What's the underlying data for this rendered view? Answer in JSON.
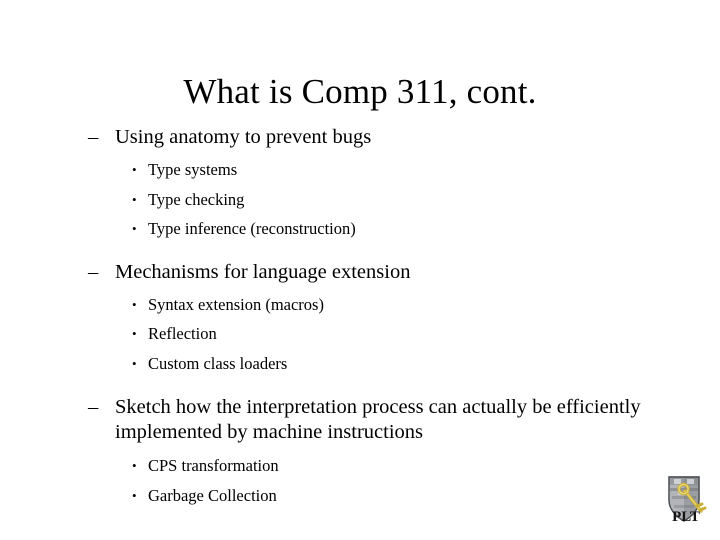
{
  "slide": {
    "title": "What is Comp 311, cont.",
    "background_color": "#ffffff",
    "text_color": "#000000",
    "dash_marker": "–",
    "dot_marker": "•",
    "groups": [
      {
        "heading": "Using anatomy to prevent bugs",
        "items": [
          "Type systems",
          "Type checking",
          "Type inference (reconstruction)"
        ]
      },
      {
        "heading": "Mechanisms for language extension",
        "items": [
          "Syntax extension (macros)",
          "Reflection",
          "Custom class loaders"
        ]
      },
      {
        "heading": "Sketch how the interpretation process can actually be efficiently implemented by machine instructions",
        "items": [
          "CPS transformation",
          "Garbage Collection"
        ]
      }
    ]
  },
  "logo": {
    "name": "plt-shield-logo",
    "text": "PLT",
    "shield_color": "#8f9296",
    "shield_highlight": "#c9ccd0",
    "shield_dark": "#5d6165",
    "key_color": "#d9c24a",
    "key_dark": "#a98f1f",
    "text_color": "#1a1a1a"
  }
}
